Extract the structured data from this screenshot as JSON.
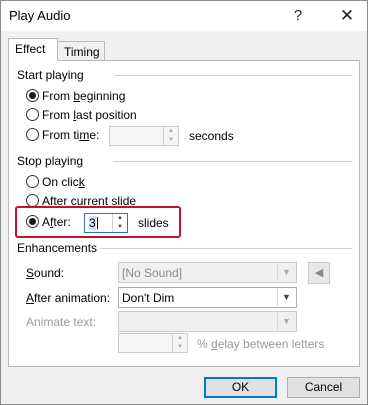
{
  "window": {
    "title": "Play Audio",
    "help_glyph": "?",
    "close_glyph": "✕"
  },
  "tabs": [
    {
      "label": "Effect"
    },
    {
      "label": "Timing"
    }
  ],
  "start_playing": {
    "heading": "Start playing",
    "options": [
      {
        "pre": "From ",
        "ul": "b",
        "post": "eginning",
        "selected": true
      },
      {
        "pre": "From ",
        "ul": "l",
        "post": "ast position",
        "selected": false
      },
      {
        "pre": "From ti",
        "ul": "m",
        "post": "e:",
        "selected": false
      }
    ],
    "time_value": "",
    "seconds_label": "seconds"
  },
  "stop_playing": {
    "heading": "Stop playing",
    "options": [
      {
        "pre": "On clic",
        "ul": "k",
        "post": "",
        "selected": false
      },
      {
        "pre": "After ",
        "ul": "c",
        "post": "urrent slide",
        "selected": false
      },
      {
        "pre": "A",
        "ul": "f",
        "post": "ter:",
        "selected": true
      }
    ],
    "after_value": "3",
    "slides_label": "slides"
  },
  "enhancements": {
    "heading": "Enhancements",
    "sound": {
      "pre": "",
      "ul": "S",
      "post": "ound:",
      "value": "[No Sound]"
    },
    "after_animation": {
      "pre": "",
      "ul": "A",
      "post": "fter animation:",
      "value": "Don't Dim"
    },
    "animate_text": {
      "label": "Animate text:",
      "value": ""
    },
    "delay": {
      "value": "",
      "pre": "% ",
      "ul": "d",
      "post": "elay between letters"
    }
  },
  "buttons": {
    "ok": "OK",
    "cancel": "Cancel"
  },
  "colors": {
    "highlight": "#c8102e",
    "default_button_border": "#0078d7"
  }
}
